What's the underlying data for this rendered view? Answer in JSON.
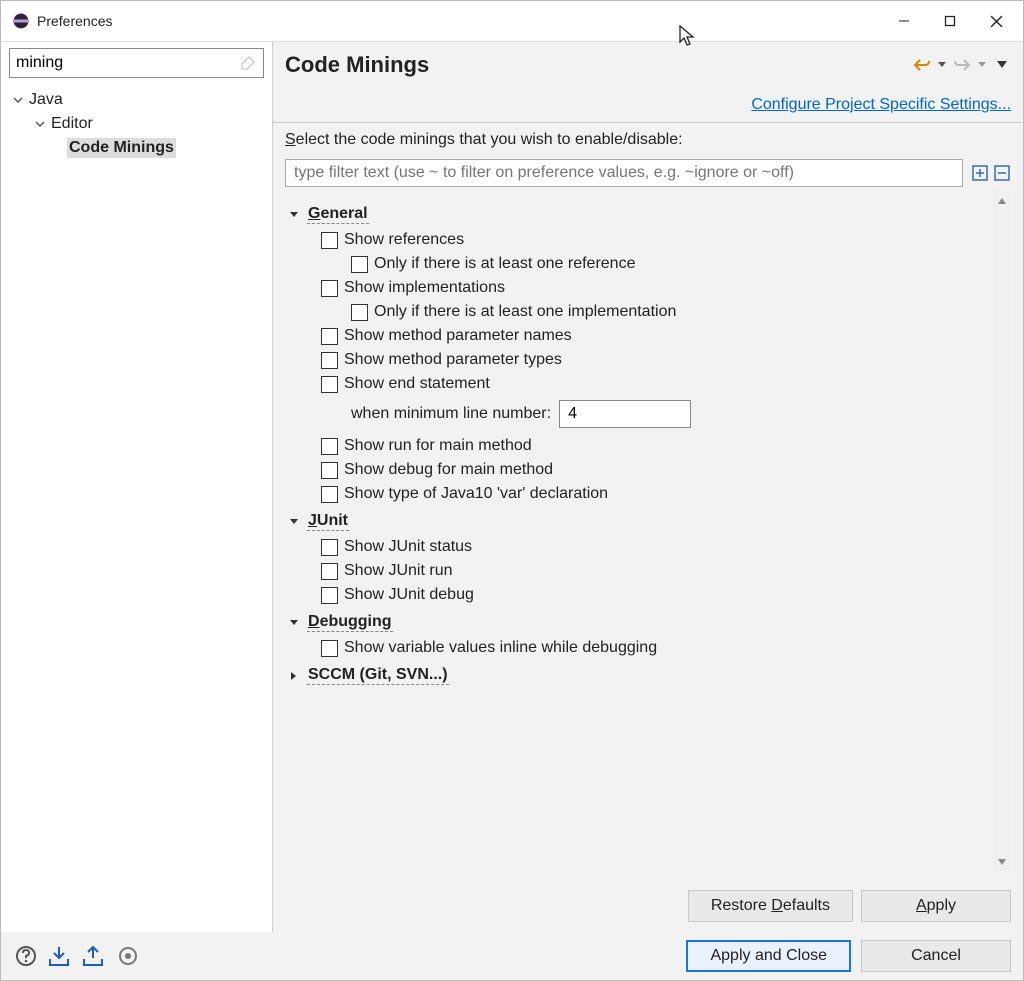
{
  "window": {
    "title": "Preferences"
  },
  "sidebar": {
    "filterValue": "mining",
    "tree": {
      "java": "Java",
      "editor": "Editor",
      "codeMinings": "Code Minings"
    }
  },
  "content": {
    "title": "Code Minings",
    "projectLink": "Configure Project Specific Settings...",
    "instructionPrefix": "elect the code minings that you wish to enable/disable:",
    "filterPlaceholder": "type filter text (use ~ to filter on preference values, e.g. ~ignore or ~off)",
    "groups": {
      "general": {
        "label": "General",
        "items": {
          "showReferences": "Show references",
          "onlyOneRef": "Only if there is at least one reference",
          "showImplementations": "Show implementations",
          "onlyOneImpl": "Only if there is at least one implementation",
          "paramNames": "Show method parameter names",
          "paramTypes": "Show method parameter types",
          "endStatement": "Show end statement",
          "minLineLabel": "when minimum line number:",
          "minLineValue": "4",
          "runMain": "Show run for main method",
          "debugMain": "Show debug for main method",
          "java10Var": "Show type of Java10 'var' declaration"
        }
      },
      "junit": {
        "label": "JUnit",
        "items": {
          "status": "Show JUnit status",
          "run": "Show JUnit run",
          "debug": "Show JUnit debug"
        }
      },
      "debugging": {
        "label": "Debugging",
        "items": {
          "inlineValues": "Show variable values inline while debugging"
        }
      },
      "sccm": {
        "label": "SCCM (Git, SVN...)"
      }
    },
    "buttons": {
      "restoreDefaultsPrefix": "Restore ",
      "restoreDefaultsSuffix": "efaults",
      "apply": "Apply"
    }
  },
  "bottom": {
    "applyClose": "Apply and Close",
    "cancel": "Cancel"
  }
}
